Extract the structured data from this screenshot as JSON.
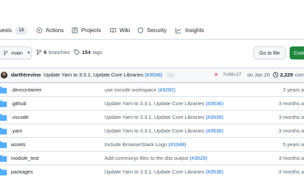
{
  "nav": {
    "items": [
      {
        "label": "uests",
        "count": "14",
        "icon": "pull-request-icon"
      },
      {
        "label": "Actions",
        "icon": "play-icon"
      },
      {
        "label": "Projects",
        "icon": "table-icon"
      },
      {
        "label": "Wiki",
        "icon": "book-icon"
      },
      {
        "label": "Security",
        "icon": "shield-icon"
      },
      {
        "label": "Insights",
        "icon": "graph-icon"
      }
    ]
  },
  "toolbar": {
    "branch": "main",
    "branches_count": "6",
    "branches_label": "branches",
    "tags_count": "154",
    "tags_label": "tags",
    "goto_file": "Go to file",
    "code": "Code"
  },
  "commit": {
    "author": "darthtrevino",
    "message": "Update Yarn to 3.3.1, Update Core Libraries",
    "pr": "(#3536)",
    "more": "…",
    "status": "✕",
    "sha": "7c88c37",
    "date": "on Jan 20",
    "count": "2,229",
    "count_label": "comm"
  },
  "files": [
    {
      "name": ".devcontainer",
      "message": "use vscode workspace",
      "pr": "(#3282)",
      "time": "2 years a"
    },
    {
      "name": ".github",
      "message": "Update Yarn to 3.3.1, Update Core Libraries",
      "pr": "(#3536)",
      "time": "3 months a"
    },
    {
      "name": ".vscode",
      "message": "Update Yarn to 3.3.1, Update Core Libraries",
      "pr": "(#3536)",
      "time": "3 months a"
    },
    {
      "name": ".yarn",
      "message": "Update Yarn to 3.3.1, Update Core Libraries",
      "pr": "(#3536)",
      "time": "3 months a"
    },
    {
      "name": "assets",
      "message": "Include BrowserStack Logo",
      "pr": "(#1048)",
      "time": "5 years a"
    },
    {
      "name": "module_test",
      "message": "Add commonjs files to the dist output",
      "pr": "(#3526)",
      "time": "3 months a"
    },
    {
      "name": "packages",
      "message": "Update Yarn to 3.3.1, Update Core Libraries",
      "pr": "(#3536)",
      "time": "3 months a"
    }
  ],
  "colors": {
    "accent": "#0969da",
    "success": "#1f883d",
    "danger": "#cf222e",
    "folder": "#54aeff"
  }
}
